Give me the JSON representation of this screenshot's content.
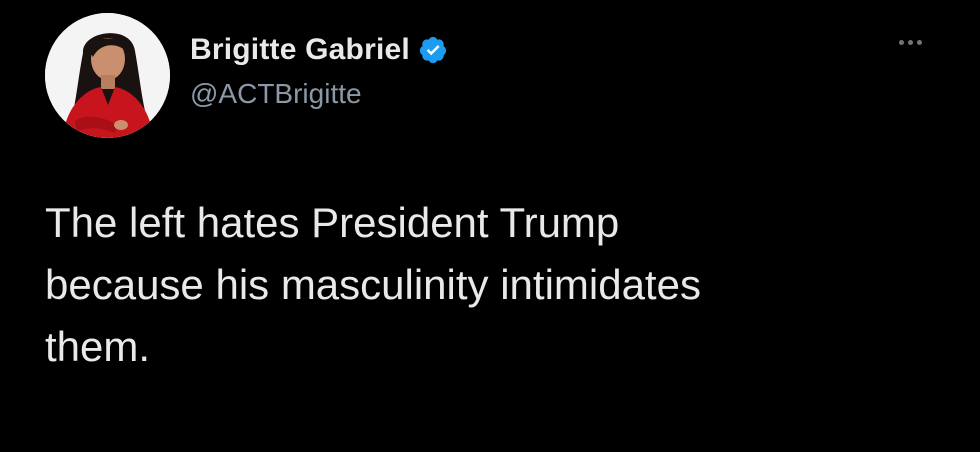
{
  "tweet": {
    "author": {
      "display_name": "Brigitte Gabriel",
      "handle": "@ACTBrigitte",
      "verified_icon": "verified-badge-icon",
      "avatar_icon": "profile-photo"
    },
    "more_icon": "more-options-icon",
    "text": "The left hates President Trump\nbecause his masculinity intimidates\nthem."
  },
  "colors": {
    "background": "#000000",
    "text": "#e7e9ea",
    "secondary_text": "#8b98a5",
    "verified_blue": "#1d9bf0"
  }
}
